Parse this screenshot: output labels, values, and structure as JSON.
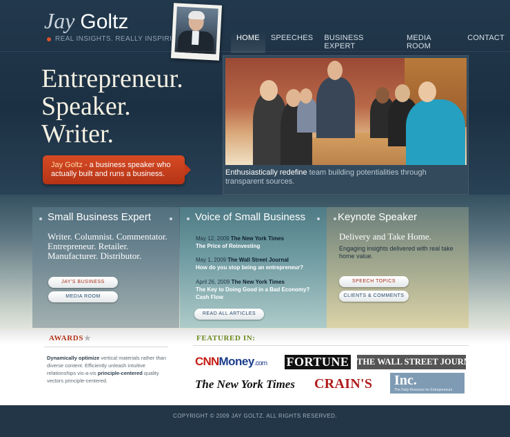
{
  "header": {
    "logo_first": "Jay",
    "logo_last": "Goltz",
    "tagline": "REAL INSIGHTS. REALLY INSPIRING."
  },
  "nav": {
    "items": [
      {
        "label": "HOME",
        "active": true
      },
      {
        "label": "SPEECHES"
      },
      {
        "label": "BUSINESS EXPERT"
      },
      {
        "label": "MEDIA ROOM"
      },
      {
        "label": "CONTACT"
      }
    ]
  },
  "hero": {
    "lines": [
      "Entrepreneur.",
      "Speaker.",
      "Writer."
    ],
    "callout_name": "Jay Goltz",
    "callout_rest": " - a business speaker who actually built and runs a business.",
    "caption_em": "Enthusiastically redefine",
    "caption_rest": " team building potentialities through transparent sources."
  },
  "col1": {
    "title": "Small Business Expert",
    "lead": "Writer. Columnist. Commentator. Entrepreneur. Retailer. Manufacturer. Distributor.",
    "button1": "JAY'S BUSINESS",
    "button2": "MEDIA ROOM"
  },
  "col2": {
    "title": "Voice of Small Business",
    "articles": [
      {
        "date": "May 12, 2009",
        "source": "The New York Times",
        "title": "The Price of Reinvesting"
      },
      {
        "date": "May 1, 2009",
        "source": "The Wall Street Journal",
        "title": "How do you stop being an entrepreneur?"
      },
      {
        "date": "April 26, 2009",
        "source": "The New York Times",
        "title": "The Key to Doing Good in a Bad Economy? Cash Flow"
      }
    ],
    "button": "READ ALL ARTICLES"
  },
  "col3": {
    "title": "Keynote Speaker",
    "lead": "Delivery and Take Home.",
    "sub": "Engaging insights delivered with real take home value.",
    "button1": "SPEECH TOPICS",
    "button2": "CLIENTS & COMMENTS"
  },
  "awards": {
    "heading": "AWARDS",
    "text_a": "Dynamically optimize",
    "text_b": " vertical materials rather than diverse content. Efficiently unleash intuitive relationships vis-a-vis ",
    "text_c": "principle-centered",
    "text_d": " quality vectors principle-centered."
  },
  "featured": {
    "heading": "FEATURED IN:",
    "cnn": "CNN",
    "money": "Money",
    "dotcom": ".com",
    "fortune": "FORTUNE",
    "wsj": "THE WALL STREET JOURNAL.",
    "nyt": "The New York Times",
    "crains": "CRAIN'S",
    "inc": "Inc.",
    "inc_sub": "The Daily Resource for Entrepreneurs"
  },
  "footer": {
    "copyright": "COPYRIGHT © 2009 JAY GOLTZ. ALL RIGHTS RESERVED."
  }
}
